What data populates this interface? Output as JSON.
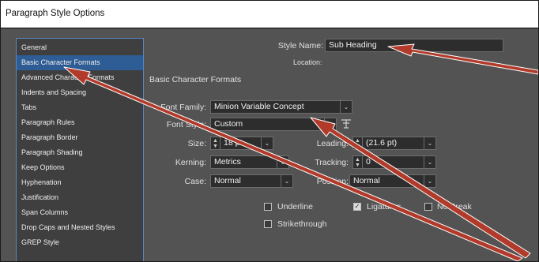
{
  "window": {
    "title": "Paragraph Style Options"
  },
  "sidebar": {
    "items": [
      {
        "label": "General"
      },
      {
        "label": "Basic Character Formats"
      },
      {
        "label": "Advanced Character Formats"
      },
      {
        "label": "Indents and Spacing"
      },
      {
        "label": "Tabs"
      },
      {
        "label": "Paragraph Rules"
      },
      {
        "label": "Paragraph Border"
      },
      {
        "label": "Paragraph Shading"
      },
      {
        "label": "Keep Options"
      },
      {
        "label": "Hyphenation"
      },
      {
        "label": "Justification"
      },
      {
        "label": "Span Columns"
      },
      {
        "label": "Drop Caps and Nested Styles"
      },
      {
        "label": "GREP Style"
      }
    ],
    "selected": "Basic Character Formats"
  },
  "header": {
    "style_name_label": "Style Name:",
    "style_name_value": "Sub Heading",
    "location_label": "Location:"
  },
  "section": {
    "title": "Basic Character Formats"
  },
  "form": {
    "font_family_label": "Font Family:",
    "font_family_value": "Minion Variable Concept",
    "font_style_label": "Font Style:",
    "font_style_value": "Custom",
    "size_label": "Size:",
    "size_value": "18 pt",
    "leading_label": "Leading:",
    "leading_value": "(21.6 pt)",
    "kerning_label": "Kerning:",
    "kerning_value": "Metrics",
    "tracking_label": "Tracking:",
    "tracking_value": "0",
    "case_label": "Case:",
    "case_value": "Normal",
    "position_label": "Position:",
    "position_value": "Normal"
  },
  "checkboxes": {
    "underline": {
      "label": "Underline",
      "checked": false
    },
    "ligatures": {
      "label": "Ligatures",
      "checked": true
    },
    "no_break": {
      "label": "No Break",
      "checked": false
    },
    "strikethrough": {
      "label": "Strikethrough",
      "checked": false
    }
  },
  "colors": {
    "panel_bg": "#535353",
    "sidebar_bg": "#3f3f3f",
    "selection": "#2e5c94",
    "arrow": "#b23a2a"
  },
  "icons": {
    "variable_font_icon": "variable-font-icon",
    "chevron": "chevron-down-icon"
  }
}
